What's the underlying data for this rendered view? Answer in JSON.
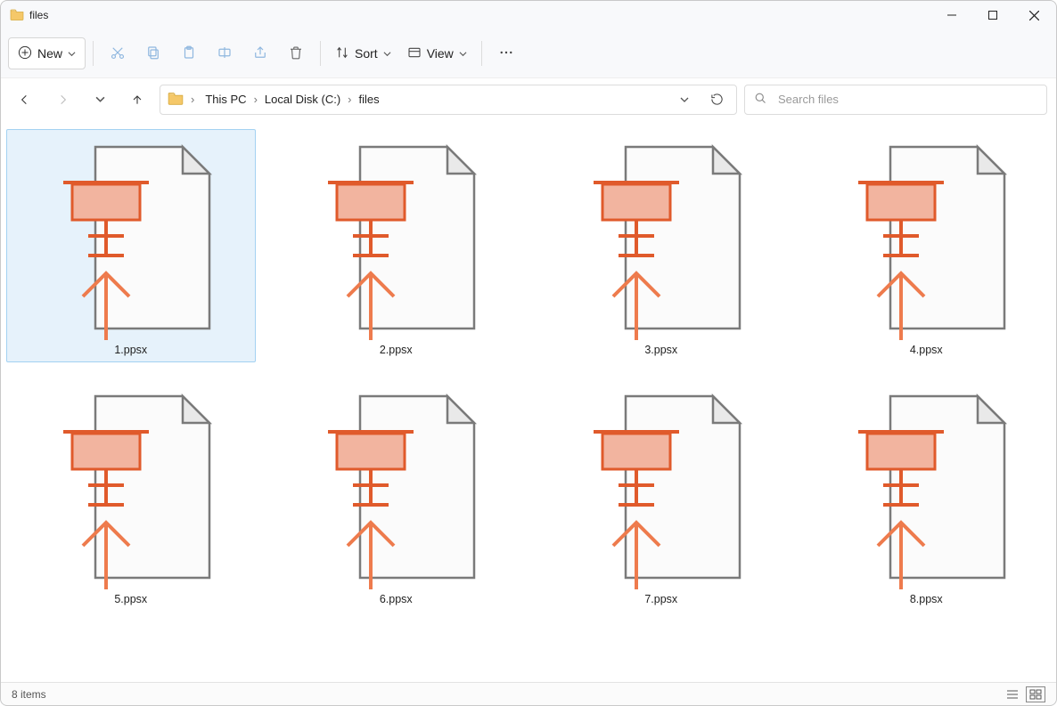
{
  "window": {
    "title": "files"
  },
  "toolbar": {
    "new_label": "New",
    "sort_label": "Sort",
    "view_label": "View"
  },
  "breadcrumb": {
    "items": [
      "This PC",
      "Local Disk (C:)",
      "files"
    ]
  },
  "search": {
    "placeholder": "Search files"
  },
  "files": [
    {
      "name": "1.ppsx",
      "selected": true
    },
    {
      "name": "2.ppsx",
      "selected": false
    },
    {
      "name": "3.ppsx",
      "selected": false
    },
    {
      "name": "4.ppsx",
      "selected": false
    },
    {
      "name": "5.ppsx",
      "selected": false
    },
    {
      "name": "6.ppsx",
      "selected": false
    },
    {
      "name": "7.ppsx",
      "selected": false
    },
    {
      "name": "8.ppsx",
      "selected": false
    }
  ],
  "status": {
    "text": "8 items"
  },
  "colors": {
    "ppsx_accent": "#e05a2b",
    "ppsx_fill": "#f2b49f"
  }
}
